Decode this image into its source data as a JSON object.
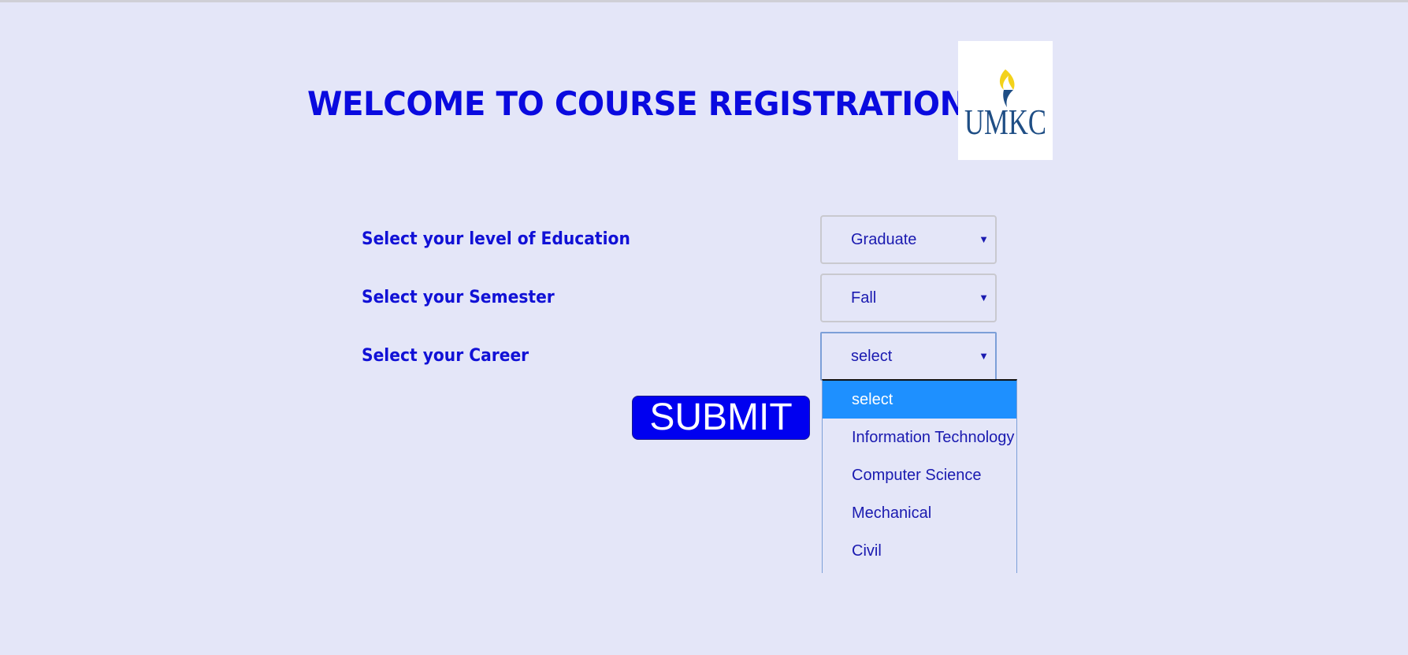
{
  "header": {
    "title": "WELCOME TO COURSE REGISTRATION",
    "logo_text": "UMKC"
  },
  "form": {
    "education": {
      "label": "Select your level of Education",
      "value": "Graduate"
    },
    "semester": {
      "label": "Select your Semester",
      "value": "Fall"
    },
    "career": {
      "label": "Select your Career",
      "value": "select",
      "options": [
        "select",
        "Information Technology",
        "Computer Science",
        "Mechanical",
        "Civil"
      ],
      "highlighted_option": "select"
    },
    "submit_label": "SUBMIT"
  },
  "colors": {
    "background": "#e4e6f8",
    "text_primary": "#0a0adf",
    "submit_button": "#0000f0",
    "option_highlight": "#1e90ff",
    "logo_blue": "#1f4e85",
    "logo_gold": "#f3d21a"
  },
  "icons": {
    "dropdown_arrow": "dropdown-arrow-icon",
    "logo_flame": "flame-icon"
  }
}
